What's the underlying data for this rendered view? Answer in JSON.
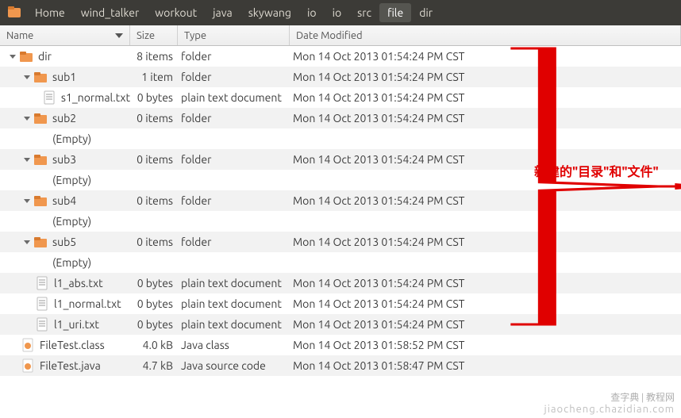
{
  "breadcrumb": [
    "Home",
    "wind_talker",
    "workout",
    "java",
    "skywang",
    "io",
    "io",
    "src",
    "file",
    "dir"
  ],
  "breadcrumb_active_index": 8,
  "columns": {
    "name": "Name",
    "size": "Size",
    "type": "Type",
    "date": "Date Modified"
  },
  "empty_label": "(Empty)",
  "rows": [
    {
      "indent": 0,
      "kind": "folder",
      "exp": true,
      "name": "dir",
      "size": "8 items",
      "type": "folder",
      "date": "Mon 14 Oct 2013 01:54:24 PM CST"
    },
    {
      "indent": 1,
      "kind": "folder",
      "exp": true,
      "name": "sub1",
      "size": "1 item",
      "type": "folder",
      "date": "Mon 14 Oct 2013 01:54:24 PM CST"
    },
    {
      "indent": 2,
      "kind": "text",
      "name": "s1_normal.txt",
      "size": "0 bytes",
      "type": "plain text document",
      "date": "Mon 14 Oct 2013 01:54:24 PM CST"
    },
    {
      "indent": 1,
      "kind": "folder",
      "exp": true,
      "name": "sub2",
      "size": "0 items",
      "type": "folder",
      "date": "Mon 14 Oct 2013 01:54:24 PM CST"
    },
    {
      "indent": 2,
      "kind": "empty"
    },
    {
      "indent": 1,
      "kind": "folder",
      "exp": true,
      "name": "sub3",
      "size": "0 items",
      "type": "folder",
      "date": "Mon 14 Oct 2013 01:54:24 PM CST"
    },
    {
      "indent": 2,
      "kind": "empty"
    },
    {
      "indent": 1,
      "kind": "folder",
      "exp": true,
      "name": "sub4",
      "size": "0 items",
      "type": "folder",
      "date": "Mon 14 Oct 2013 01:54:24 PM CST"
    },
    {
      "indent": 2,
      "kind": "empty"
    },
    {
      "indent": 1,
      "kind": "folder",
      "exp": true,
      "name": "sub5",
      "size": "0 items",
      "type": "folder",
      "date": "Mon 14 Oct 2013 01:54:24 PM CST"
    },
    {
      "indent": 2,
      "kind": "empty"
    },
    {
      "indent": 1,
      "kind": "text",
      "name": "l1_abs.txt",
      "size": "0 bytes",
      "type": "plain text document",
      "date": "Mon 14 Oct 2013 01:54:24 PM CST"
    },
    {
      "indent": 1,
      "kind": "text",
      "name": "l1_normal.txt",
      "size": "0 bytes",
      "type": "plain text document",
      "date": "Mon 14 Oct 2013 01:54:24 PM CST"
    },
    {
      "indent": 1,
      "kind": "text",
      "name": "l1_uri.txt",
      "size": "0 bytes",
      "type": "plain text document",
      "date": "Mon 14 Oct 2013 01:54:24 PM CST"
    },
    {
      "indent": 0,
      "kind": "javaclass",
      "name": "FileTest.class",
      "size": "4.0 kB",
      "type": "Java class",
      "date": "Mon 14 Oct 2013 01:58:52 PM CST"
    },
    {
      "indent": 0,
      "kind": "java",
      "name": "FileTest.java",
      "size": "4.7 kB",
      "type": "Java source code",
      "date": "Mon 14 Oct 2013 01:58:47 PM CST"
    }
  ],
  "annotation": "新建的\"目录\"和\"文件\"",
  "watermark_top": "查字典 | 教程网",
  "watermark_bottom": "jiaocheng.chazidian.com"
}
